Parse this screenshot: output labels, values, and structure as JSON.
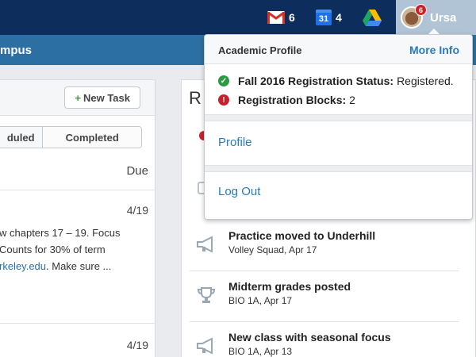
{
  "topbar": {
    "mail_count": "6",
    "calendar_day": "31",
    "calendar_count": "4",
    "user_name": "Ursa",
    "avatar_badge": "6"
  },
  "campus": {
    "label": "mpus"
  },
  "tasks_panel": {
    "new_task_label": "New Task",
    "tabs": [
      "duled",
      "Completed"
    ],
    "due_header": "Due",
    "tasks": [
      {
        "date": "4/19",
        "text_lines": [
          "w chapters 17 – 19. Focus",
          "Counts for 30% of term"
        ],
        "link_text": "rkeley.edu",
        "after_link": ". Make sure ..."
      },
      {
        "date": "4/19"
      }
    ]
  },
  "notifications_panel": {
    "title": "R",
    "items": [
      {
        "title": "Practice moved to Underhill",
        "sub": "Volley Squad, Apr 17",
        "icon": "megaphone-icon"
      },
      {
        "title": "Midterm grades posted",
        "sub": "BIO 1A, Apr 17",
        "icon": "trophy-icon"
      },
      {
        "title": "New class with seasonal focus",
        "sub": "BIO 1A, Apr 13",
        "icon": "megaphone-icon"
      }
    ]
  },
  "dropdown": {
    "title": "Academic Profile",
    "more_info": "More Info",
    "registration_status_label": "Fall 2016 Registration Status:",
    "registration_status_value": "Registered.",
    "registration_blocks_label": "Registration Blocks:",
    "registration_blocks_value": "2",
    "profile_link": "Profile",
    "logout_link": "Log Out"
  },
  "colors": {
    "topbar": "#0d2e5c",
    "subbar": "#2c6fa3",
    "link": "#2a7ab5",
    "ok": "#2a9a43",
    "error": "#c7202c"
  }
}
